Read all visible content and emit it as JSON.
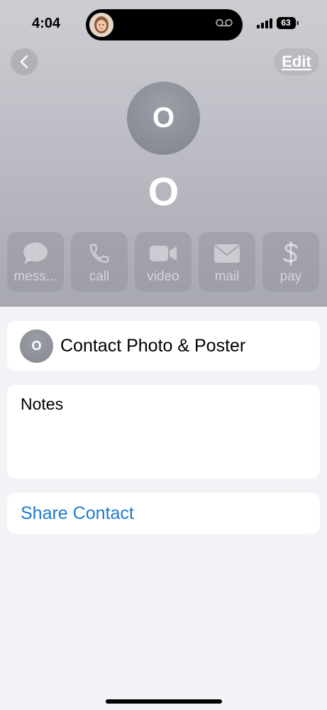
{
  "status_bar": {
    "time": "4:04",
    "battery": "63"
  },
  "nav": {
    "edit_label": "Edit"
  },
  "contact": {
    "initial": "O",
    "name": "O"
  },
  "actions": [
    {
      "label": "mess...",
      "icon": "message-icon"
    },
    {
      "label": "call",
      "icon": "phone-icon"
    },
    {
      "label": "video",
      "icon": "video-icon"
    },
    {
      "label": "mail",
      "icon": "mail-icon"
    },
    {
      "label": "pay",
      "icon": "dollar-icon"
    }
  ],
  "photo_poster": {
    "initial": "O",
    "label": "Contact Photo & Poster"
  },
  "notes": {
    "label": "Notes"
  },
  "share": {
    "label": "Share Contact"
  },
  "colors": {
    "accent": "#1f7bd0",
    "background": "#f2f2f7"
  }
}
